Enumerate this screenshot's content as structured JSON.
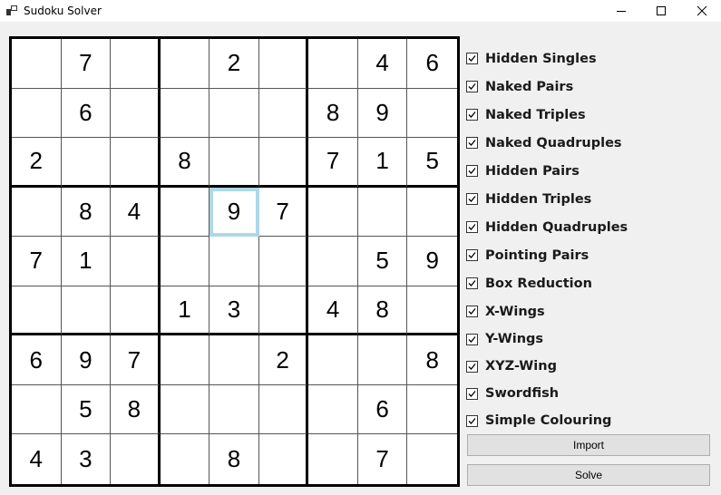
{
  "window": {
    "title": "Sudoku Solver"
  },
  "grid": {
    "rows": [
      [
        "",
        "7",
        "",
        "",
        "2",
        "",
        "",
        "4",
        "6"
      ],
      [
        "",
        "6",
        "",
        "",
        "",
        "",
        "8",
        "9",
        ""
      ],
      [
        "2",
        "",
        "",
        "8",
        "",
        "",
        "7",
        "1",
        "5"
      ],
      [
        "",
        "8",
        "4",
        "",
        "9",
        "7",
        "",
        "",
        ""
      ],
      [
        "7",
        "1",
        "",
        "",
        "",
        "",
        "",
        "5",
        "9"
      ],
      [
        "",
        "",
        "",
        "1",
        "3",
        "",
        "4",
        "8",
        ""
      ],
      [
        "6",
        "9",
        "7",
        "",
        "",
        "2",
        "",
        "",
        "8"
      ],
      [
        "",
        "5",
        "8",
        "",
        "",
        "",
        "",
        "6",
        ""
      ],
      [
        "4",
        "3",
        "",
        "",
        "8",
        "",
        "",
        "7",
        ""
      ]
    ],
    "selected_cell": {
      "row": 3,
      "col": 4
    },
    "selection_color": "#add8e6"
  },
  "strategies": [
    {
      "label": "Hidden Singles",
      "checked": true
    },
    {
      "label": "Naked Pairs",
      "checked": true
    },
    {
      "label": "Naked Triples",
      "checked": true
    },
    {
      "label": "Naked Quadruples",
      "checked": true
    },
    {
      "label": "Hidden Pairs",
      "checked": true
    },
    {
      "label": "Hidden Triples",
      "checked": true
    },
    {
      "label": "Hidden Quadruples",
      "checked": true
    },
    {
      "label": "Pointing Pairs",
      "checked": true
    },
    {
      "label": "Box Reduction",
      "checked": true
    },
    {
      "label": "X-Wings",
      "checked": true
    },
    {
      "label": "Y-Wings",
      "checked": true
    },
    {
      "label": "XYZ-Wing",
      "checked": true
    },
    {
      "label": "Swordfish",
      "checked": true
    },
    {
      "label": "Simple Colouring",
      "checked": true
    }
  ],
  "buttons": {
    "import_label": "Import",
    "solve_label": "Solve"
  }
}
